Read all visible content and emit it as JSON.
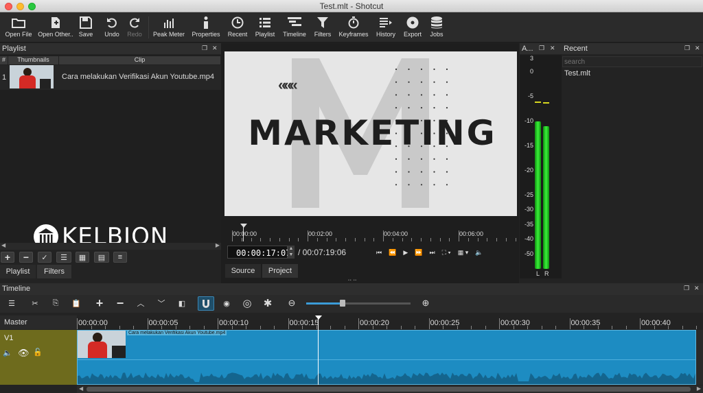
{
  "window": {
    "title": "Test.mlt - Shotcut"
  },
  "toolbar": {
    "open_file": "Open File",
    "open_other": "Open Other..",
    "save": "Save",
    "undo": "Undo",
    "redo": "Redo",
    "peak_meter": "Peak Meter",
    "properties": "Properties",
    "recent": "Recent",
    "playlist": "Playlist",
    "timeline": "Timeline",
    "filters": "Filters",
    "keyframes": "Keyframes",
    "history": "History",
    "export": "Export",
    "jobs": "Jobs"
  },
  "playlist": {
    "title": "Playlist",
    "col_num": "#",
    "col_thumbs": "Thumbnails",
    "col_clip": "Clip",
    "rows": [
      {
        "num": "1",
        "clip": "Cara melakukan Verifikasi Akun Youtube.mp4"
      }
    ],
    "tab_playlist": "Playlist",
    "tab_filters": "Filters"
  },
  "watermark": {
    "text": "KELBION"
  },
  "preview": {
    "headline": "MARKETING",
    "arrows": "«««"
  },
  "player": {
    "ruler_labels": [
      "00:00:00",
      "00:02:00",
      "00:04:00",
      "00:06:00"
    ],
    "timecode": "00:00:17:07",
    "duration": "/ 00:07:19:06",
    "tab_source": "Source",
    "tab_project": "Project"
  },
  "audio_meter": {
    "title": "A...",
    "scale": [
      "3",
      "0",
      "-5",
      "-10",
      "-15",
      "-20",
      "-25",
      "-30",
      "-35",
      "-40",
      "-50"
    ],
    "left": "L",
    "right": "R",
    "level_left_db": -10,
    "level_right_db": -11
  },
  "recent": {
    "title": "Recent",
    "search_placeholder": "search",
    "items": [
      "Test.mlt"
    ]
  },
  "timeline": {
    "title": "Timeline",
    "master": "Master",
    "track": "V1",
    "ruler_labels": [
      "00:00:00",
      "00:00:05",
      "00:00:10",
      "00:00:15",
      "00:00:20",
      "00:00:25",
      "00:00:30",
      "00:00:35",
      "00:00:40"
    ],
    "clip_name": "Cara melakukan Verifikasi Akun Youtube.mp4",
    "zoom_level": 0.35
  },
  "colors": {
    "accent": "#1a8fc0",
    "track_header": "#6e6b1d",
    "meter_green": "#22d422"
  }
}
